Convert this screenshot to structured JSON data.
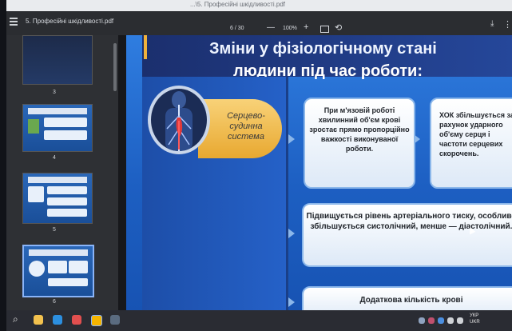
{
  "browser": {
    "url_fragment": "...\\5. Професійні шкідливості.pdf",
    "document_title": "5. Професійні шкідливості.pdf"
  },
  "toolbar": {
    "page_indicator": "6 / 30",
    "zoom_minus": "—",
    "zoom_level": "100%",
    "zoom_plus": "+"
  },
  "sidebar": {
    "thumbnails": [
      {
        "number": "3"
      },
      {
        "number": "4"
      },
      {
        "number": "5"
      },
      {
        "number": "6"
      }
    ]
  },
  "slide": {
    "title_line1": "Зміни у фізіологічному стані",
    "title_line2": "людини під час роботи:",
    "category": "Серцево-судинна система",
    "card1": "При м'язовій роботі хвилинний об'єм крові зростає прямо пропорційно важкості виконуваної роботи.",
    "card2": "ХОК збільшується за рахунок ударного об'єму серця і частоти серцевих скорочень.",
    "card3": "Підвищується рівень артеріального тиску, особливо збільшується систолічний, менше — діастолічний.",
    "card4": "Додаткова кількість крові"
  },
  "taskbar": {
    "language": "УКР",
    "region": "UKR"
  },
  "colors": {
    "slide_blue": "#2f7de0",
    "header_navy": "#1b2f6e",
    "pill_orange": "#f0b23b",
    "card_border": "#8bb7ea"
  }
}
